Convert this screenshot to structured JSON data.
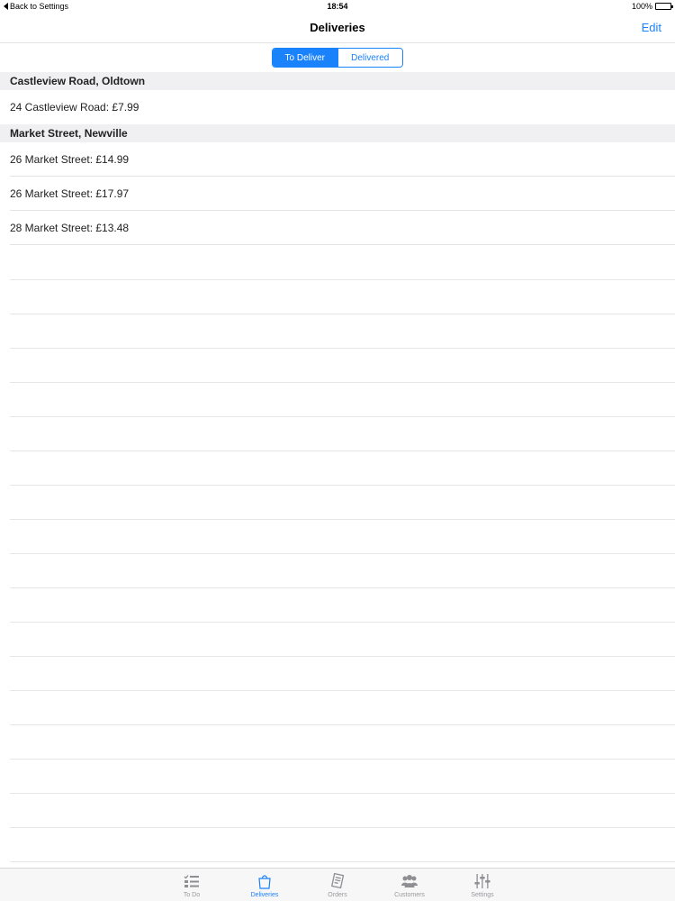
{
  "status": {
    "back_label": "Back to Settings",
    "time": "18:54",
    "battery": "100%"
  },
  "nav": {
    "title": "Deliveries",
    "edit_label": "Edit"
  },
  "segments": [
    {
      "label": "To Deliver"
    },
    {
      "label": "Delivered"
    }
  ],
  "sections": [
    {
      "header": "Castleview Road, Oldtown",
      "rows": [
        "24 Castleview Road: £7.99"
      ]
    },
    {
      "header": "Market Street, Newville",
      "rows": [
        "26 Market Street: £14.99",
        "26 Market Street: £17.97",
        "28 Market Street: £13.48"
      ]
    }
  ],
  "tabs": [
    {
      "label": "To Do",
      "icon": "checklist-icon"
    },
    {
      "label": "Deliveries",
      "icon": "shopping-bag-icon"
    },
    {
      "label": "Orders",
      "icon": "receipt-icon"
    },
    {
      "label": "Customers",
      "icon": "people-icon"
    },
    {
      "label": "Settings",
      "icon": "sliders-icon"
    }
  ],
  "colors": {
    "accent": "#1a82fb",
    "inactive_tab": "#9a9a9e",
    "section_bg": "#f0f0f3"
  }
}
